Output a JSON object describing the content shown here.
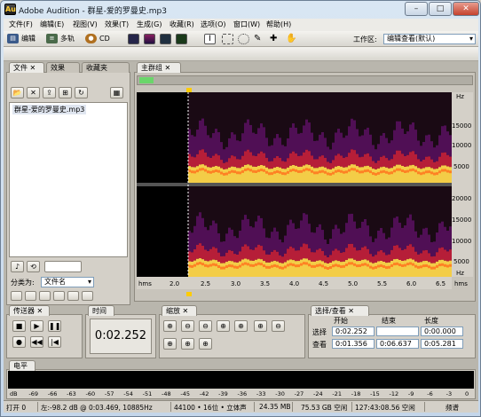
{
  "window": {
    "title": "Adobe Audition - 群星-爱的罗曼史.mp3",
    "app_icon": "Au",
    "minimize": "–",
    "maximize": "□",
    "close": "✕"
  },
  "menu": [
    "文件(F)",
    "编辑(E)",
    "视图(V)",
    "效果(T)",
    "生成(G)",
    "收藏(R)",
    "选项(O)",
    "窗口(W)",
    "帮助(H)"
  ],
  "toolbar": {
    "modes": [
      {
        "label": "编辑",
        "icon": "edit-view-icon"
      },
      {
        "label": "多轨",
        "icon": "multitrack-view-icon"
      },
      {
        "label": "CD",
        "icon": "cd-view-icon"
      }
    ],
    "workspace_label": "工作区:",
    "workspace_value": "编辑查看(默认)"
  },
  "files_panel": {
    "tabs": [
      "文件",
      "效果",
      "收藏夹"
    ],
    "file_item": "群星-爱的罗曼史.mp3",
    "sort_label": "分类为:",
    "sort_value": "文件名"
  },
  "editor": {
    "tab": "主群组",
    "freq_unit": "Hz",
    "channel1_ticks": [
      "15000",
      "10000",
      "5000"
    ],
    "channel2_ticks": [
      "20000",
      "15000",
      "10000",
      "5000"
    ],
    "time_unit": "hms",
    "time_ticks": [
      "2.0",
      "2.5",
      "3.0",
      "3.5",
      "4.0",
      "4.5",
      "5.0",
      "5.5",
      "6.0",
      "6.5"
    ],
    "time_end": "hms"
  },
  "transport": {
    "title": "传送器"
  },
  "time_panel": {
    "title": "时间",
    "value": "0:02.252"
  },
  "zoom_panel": {
    "title": "缩放"
  },
  "selection_panel": {
    "title": "选择/查看",
    "col_start": "开始",
    "col_end": "结束",
    "col_length": "长度",
    "rows": [
      {
        "label": "选择",
        "start": "0:02.252",
        "end": "",
        "length": "0:00.000"
      },
      {
        "label": "查看",
        "start": "0:01.356",
        "end": "0:06.637",
        "length": "0:05.281"
      }
    ]
  },
  "level_panel": {
    "title": "电平",
    "ticks": [
      "dB",
      "-69",
      "-66",
      "-63",
      "-60",
      "-57",
      "-54",
      "-51",
      "-48",
      "-45",
      "-42",
      "-39",
      "-36",
      "-33",
      "-30",
      "-27",
      "-24",
      "-21",
      "-18",
      "-15",
      "-12",
      "-9",
      "-6",
      "-3",
      "0"
    ]
  },
  "status": {
    "state": "打开 0",
    "left": "左:-98.2 dB @ 0:03.469, 10885Hz",
    "format": "44100 • 16位 • 立体声",
    "size": "24.35 MB",
    "free": "75.53 GB 空闲",
    "free_time": "127:43:08.56 空闲",
    "view": "频谱"
  },
  "colors": {
    "spectro_bg": "#1a0a14",
    "spectro_hot": "#ffe060",
    "accent": "#ffcc00"
  }
}
